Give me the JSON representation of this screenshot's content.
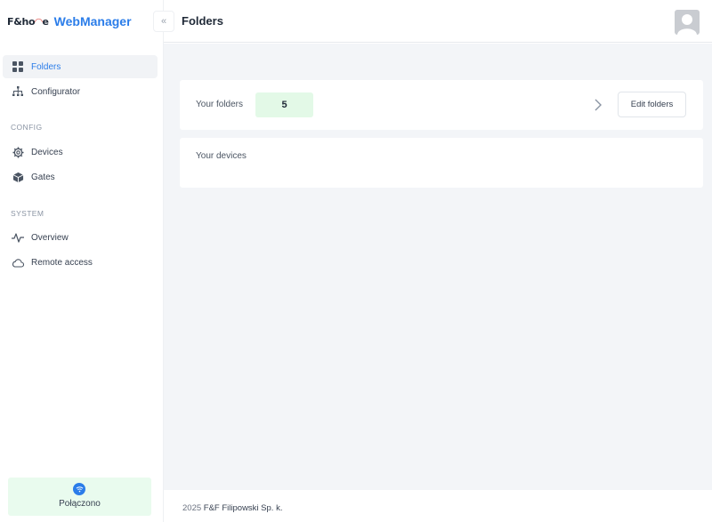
{
  "brand": {
    "logo_text": "F&home",
    "app_name": "WebManager"
  },
  "header": {
    "title": "Folders",
    "collapse_icon": "«"
  },
  "sidebar": {
    "main_items": [
      {
        "label": "Folders",
        "icon": "grid-icon",
        "active": true
      },
      {
        "label": "Configurator",
        "icon": "sitemap-icon",
        "active": false
      }
    ],
    "sections": [
      {
        "title": "CONFIG",
        "items": [
          {
            "label": "Devices",
            "icon": "cog-icon"
          },
          {
            "label": "Gates",
            "icon": "cube-icon"
          }
        ]
      },
      {
        "title": "SYSTEM",
        "items": [
          {
            "label": "Overview",
            "icon": "pulse-icon"
          },
          {
            "label": "Remote access",
            "icon": "cloud-icon"
          }
        ]
      }
    ],
    "status": {
      "label": "Połączono",
      "icon": "wifi-icon",
      "color": "#2b7de9"
    }
  },
  "main": {
    "folders_card": {
      "label": "Your folders",
      "count": "5",
      "edit_label": "Edit folders"
    },
    "devices_card": {
      "label": "Your devices"
    }
  },
  "footer": {
    "year": "2025",
    "company": "F&F Filipowski Sp. k."
  },
  "colors": {
    "accent": "#2b7de9",
    "success_bg": "#e3f9e7",
    "main_bg": "#f3f5f8"
  }
}
